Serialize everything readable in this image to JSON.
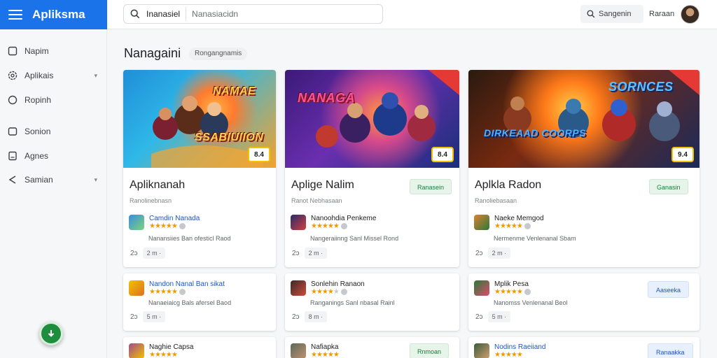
{
  "app": {
    "title": "Apliksma"
  },
  "search": {
    "query": "Inanasiel",
    "placeholder": "Nanasiacidn"
  },
  "header": {
    "search_button": "Sangenin",
    "signin": "Raraan"
  },
  "sidebar": {
    "items": [
      {
        "label": "Napim",
        "icon": "square-icon"
      },
      {
        "label": "Aplikais",
        "icon": "settings-icon",
        "caret": "▾"
      },
      {
        "label": "Ropinh",
        "icon": "circle-icon"
      },
      {
        "label": "Sonion",
        "icon": "folder-icon"
      },
      {
        "label": "Agnes",
        "icon": "document-icon"
      },
      {
        "label": "Samian",
        "icon": "share-icon",
        "caret": "▾"
      }
    ]
  },
  "main": {
    "title": "Nanagaini",
    "subtitle": "Rongangnamis"
  },
  "featured": [
    {
      "banner_title": "NAMAE",
      "banner_title2": "SSABIUIION",
      "banner_badge": "8.4",
      "title": "Apliknanah",
      "meta": "Ranolinebnasn",
      "install": "",
      "app_name": "Camdin Nanada",
      "app_desc": "Nanansiies Ban ofesticl Raod",
      "foot_icon": "2ɔ",
      "foot_pill": "2 m  ·"
    },
    {
      "banner_title": "NANAGA",
      "banner_title2": "",
      "banner_badge": "8.4",
      "title": "Aplige Nalim",
      "meta": "Ranot Nebhasaan",
      "install": "Ranasein",
      "app_name": "Nanoohdia Penkeme",
      "app_desc": "Nangeraiinng Sanl Missel Rond",
      "foot_icon": "2ɔ",
      "foot_pill": "2 m  ·"
    },
    {
      "banner_title": "SORNCES",
      "banner_title2": "DIRKEAAD COORPS",
      "banner_badge": "9.4",
      "title": "Aplkla Radon",
      "meta": "Ranoliebasaan",
      "install": "Ganasin",
      "app_name": "Naeke Memgod",
      "app_desc": "Nermenme Venlenanal Sbam",
      "foot_icon": "2ɔ",
      "foot_pill": "2 m  ·"
    }
  ],
  "list_cards": [
    {
      "app_name": "Nandon Nanal Ban sikat",
      "app_desc": "Nanaeiaicg Bals afersel Baod",
      "foot_icon": "2ɔ",
      "foot_pill": "5 m  ·",
      "button": ""
    },
    {
      "app_name": "Sonlehin Ranaon",
      "app_desc": "Ranganings Sanl nbasal Rainl",
      "foot_icon": "2ɔ",
      "foot_pill": "8 m  ·",
      "button": ""
    },
    {
      "app_name": "Mplik Pesa",
      "app_desc": "Nanomss Venlenanal Beol",
      "foot_icon": "2ɔ",
      "foot_pill": "5 m  ·",
      "button": "Aaseeka"
    }
  ],
  "bottom_cards": [
    {
      "app_name": "Naghie Capsa",
      "button": ""
    },
    {
      "app_name": "Nafiapka",
      "button": "Rnmoan"
    },
    {
      "app_name": "Nodins Raeiiand",
      "button": "Ranaakka"
    }
  ],
  "colors": {
    "brand": "#1a73e8",
    "install_green": "#188038",
    "star": "#f29900",
    "link": "#1a56c5"
  }
}
